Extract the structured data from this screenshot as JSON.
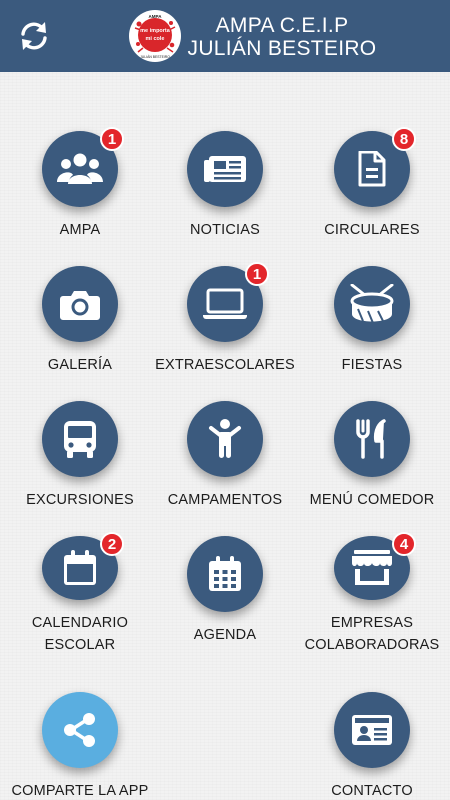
{
  "header": {
    "title_line1": "AMPA C.E.I.P",
    "title_line2": "JULIÁN BESTEIRO",
    "logo_text_top": "AMPA",
    "logo_text_main": "me importa mi cole",
    "logo_text_bottom": "JULIÁN BESTEIRO"
  },
  "menu": [
    {
      "label": "AMPA",
      "icon": "group-icon",
      "badge": "1"
    },
    {
      "label": "NOTICIAS",
      "icon": "newspaper-icon",
      "badge": ""
    },
    {
      "label": "CIRCULARES",
      "icon": "document-icon",
      "badge": "8"
    },
    {
      "label": "GALERÍA",
      "icon": "camera-icon",
      "badge": ""
    },
    {
      "label": "EXTRAESCOLARES",
      "icon": "laptop-icon",
      "badge": "1"
    },
    {
      "label": "FIESTAS",
      "icon": "drum-icon",
      "badge": ""
    },
    {
      "label": "EXCURSIONES",
      "icon": "bus-icon",
      "badge": ""
    },
    {
      "label": "CAMPAMENTOS",
      "icon": "child-icon",
      "badge": ""
    },
    {
      "label": "MENÚ COMEDOR",
      "icon": "utensils-icon",
      "badge": ""
    },
    {
      "label": "CALENDARIO\nESCOLAR",
      "icon": "calendar-icon",
      "badge": "2"
    },
    {
      "label": "AGENDA",
      "icon": "calendar-grid-icon",
      "badge": ""
    },
    {
      "label": "EMPRESAS\nCOLABORADORAS",
      "icon": "store-icon",
      "badge": "4"
    },
    {
      "label": "COMPARTE LA APP",
      "icon": "share-icon",
      "badge": ""
    },
    {
      "label": "CONTACTO",
      "icon": "contact-card-icon",
      "badge": ""
    }
  ],
  "colors": {
    "header": "#3b5a7e",
    "circle": "#3b5a7e",
    "share_circle": "#5aaee0",
    "badge": "#e3262b"
  }
}
